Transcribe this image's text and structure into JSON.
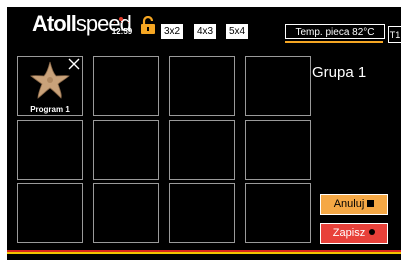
{
  "header": {
    "logo_bold": "Atoll",
    "logo_light": "speed",
    "clock_time": "12:59",
    "lock_icon": "open-lock-icon",
    "grid_options": [
      "3x2",
      "4x3",
      "5x4"
    ],
    "temperature_label": "Temp. pieca 82°C",
    "oven_id": "T1"
  },
  "programs": [
    {
      "label": "Program 1",
      "icon": "starfish-icon",
      "removable": true
    },
    {
      "label": ""
    },
    {
      "label": ""
    },
    {
      "label": ""
    },
    {
      "label": ""
    },
    {
      "label": ""
    },
    {
      "label": ""
    },
    {
      "label": ""
    },
    {
      "label": ""
    },
    {
      "label": ""
    },
    {
      "label": ""
    },
    {
      "label": ""
    }
  ],
  "group": {
    "title": "Grupa 1"
  },
  "actions": {
    "cancel_label": "Anuluj",
    "save_label": "Zapisz"
  },
  "colors": {
    "background": "#000000",
    "cancel": "#f5a845",
    "save": "#e8413a",
    "temp_indicator": "#f5a623",
    "flag_red": "#d8261e",
    "flag_yellow": "#f2c300"
  }
}
